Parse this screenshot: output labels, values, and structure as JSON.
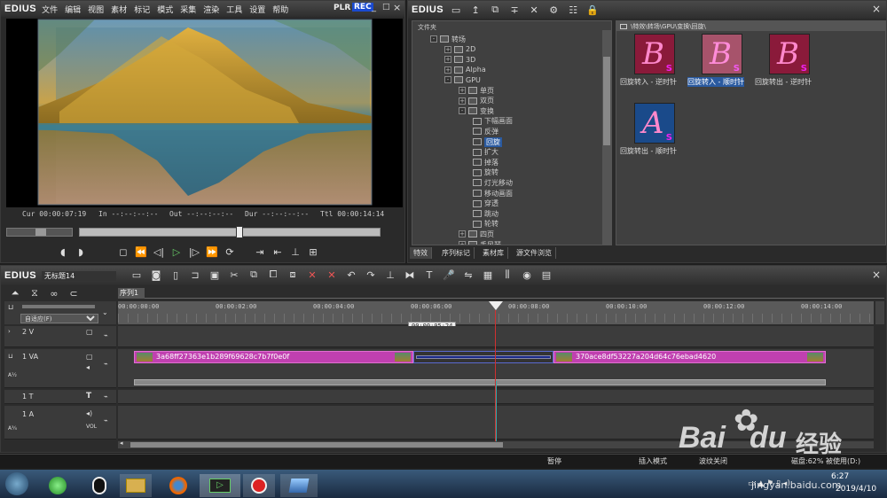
{
  "player": {
    "app_name": "EDIUS",
    "menu": [
      "文件",
      "编辑",
      "视图",
      "素材",
      "标记",
      "模式",
      "采集",
      "渲染",
      "工具",
      "设置",
      "帮助"
    ],
    "plr": "PLR",
    "rec": "REC",
    "timecodes": {
      "cur": "Cur 00:00:07:19",
      "in": "In --:--:--:--",
      "out": "Out --:--:--:--",
      "dur": "Dur --:--:--:--",
      "ttl": "Ttl 00:00:14:14"
    },
    "position_fraction": 0.53
  },
  "bin": {
    "app_name": "EDIUS",
    "tree_header": "文件夹",
    "path": "\\特效\\转场\\GPU\\变换\\回旋\\",
    "tree": [
      {
        "label": "转场",
        "type": "folder",
        "exp": "-"
      },
      {
        "label": "2D",
        "type": "folder",
        "exp": "+"
      },
      {
        "label": "3D",
        "type": "folder",
        "exp": "+"
      },
      {
        "label": "Alpha",
        "type": "folder",
        "exp": "+"
      },
      {
        "label": "GPU",
        "type": "folder",
        "exp": "-"
      },
      {
        "label": "单页",
        "type": "folder",
        "exp": "+"
      },
      {
        "label": "双页",
        "type": "folder",
        "exp": "+"
      },
      {
        "label": "变换",
        "type": "folder",
        "exp": "-"
      },
      {
        "label": "下幅画面",
        "type": "fx"
      },
      {
        "label": "反弹",
        "type": "fx"
      },
      {
        "label": "回旋",
        "type": "fx",
        "selected": true
      },
      {
        "label": "扩大",
        "type": "fx"
      },
      {
        "label": "掉落",
        "type": "fx"
      },
      {
        "label": "旋转",
        "type": "fx"
      },
      {
        "label": "灯光移动",
        "type": "fx"
      },
      {
        "label": "移动画面",
        "type": "fx"
      },
      {
        "label": "穿透",
        "type": "fx"
      },
      {
        "label": "跳动",
        "type": "fx"
      },
      {
        "label": "轮转",
        "type": "fx"
      },
      {
        "label": "四页",
        "type": "folder",
        "exp": "+"
      },
      {
        "label": "手风琴",
        "type": "folder",
        "exp": "+"
      }
    ],
    "tabs": [
      "特效",
      "序列标记",
      "素材库",
      "源文件浏览"
    ],
    "effects": [
      {
        "label": "回旋转入 - 逆时针",
        "letter": "B"
      },
      {
        "label": "回旋转入 - 顺时针",
        "letter": "B",
        "selected": true
      },
      {
        "label": "回旋转出 - 逆时针",
        "letter": "B"
      },
      {
        "label": "回旋转出 - 顺时针",
        "letter": "A"
      }
    ]
  },
  "timeline": {
    "app_name": "EDIUS",
    "project_name": "无标题14",
    "sequence_tab": "序列1",
    "mode_select": "自适应(F)",
    "ruler": [
      "00:00:00:00",
      "00:00:02:00",
      "00:00:04:00",
      "00:00:06:00",
      "00:00:08:00",
      "00:00:10:00",
      "00:00:12:00",
      "00:00:14:00"
    ],
    "hover_timecode": "00:00:05:24",
    "tracks": {
      "v2": "2 V",
      "va1": "1 VA",
      "t1": "1 T",
      "a1": "1 A",
      "vol": "VOL"
    },
    "clips": {
      "clip1": "3a68ff27363e1b289f69628c7b7f0e0f",
      "clip2": "370ace8df53227a204d64c76ebad4620"
    }
  },
  "statusbar": {
    "pause": "暂停",
    "insert_mode": "插入模式",
    "ripple": "波纹关闭",
    "disk": "磁盘:62% 被使用(D:)"
  },
  "taskbar": {
    "time": "6:27",
    "date": "2019/4/10"
  },
  "watermark": {
    "brand": "Bai",
    "brand2": "du",
    "cn": "经验",
    "url": "jingyan.baidu.com"
  },
  "colors": {
    "clip": "#c040b0",
    "playhead": "#d03030",
    "selection": "#2a5aa0",
    "rec": "#1a4ad0"
  }
}
